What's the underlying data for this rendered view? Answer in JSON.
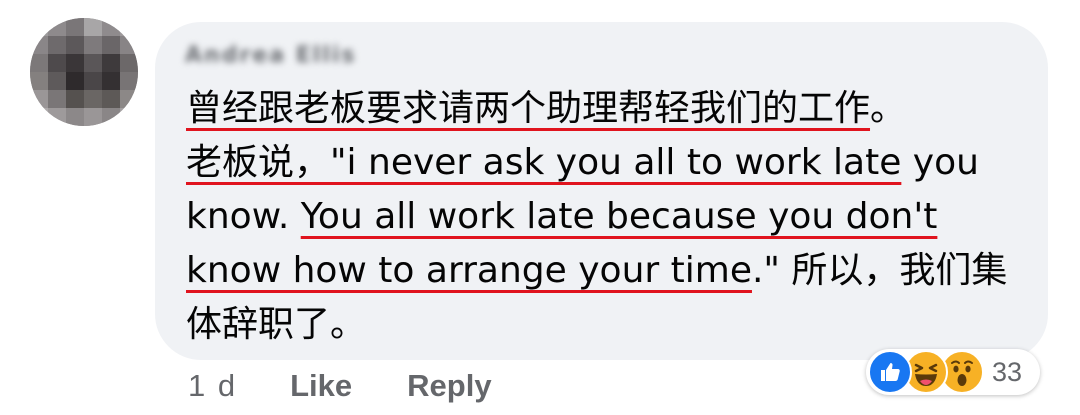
{
  "author": {
    "name": "Andrea Ellis"
  },
  "comment": {
    "segments": [
      {
        "text": "曾经跟老板要求请两个助理帮轻我们的工作",
        "underline": true
      },
      {
        "text": "。",
        "underline": false
      },
      {
        "text": "\n",
        "underline": false
      },
      {
        "text": "老板说，\"i never ask you all to work late",
        "underline": true
      },
      {
        "text": " you know. ",
        "underline": false
      },
      {
        "text": "You all work late because you don't know how to arrange your time",
        "underline": true
      },
      {
        "text": ".\" 所以，我们集体辞职了。",
        "underline": false
      }
    ]
  },
  "meta": {
    "time": "1 d",
    "like_label": "Like",
    "reply_label": "Reply"
  },
  "reactions": {
    "count": "33",
    "icons": [
      "like-reaction-icon",
      "haha-reaction-icon",
      "wow-reaction-icon"
    ]
  },
  "colors": {
    "bubble": "#f0f2f5",
    "underline": "#e0141e",
    "meta_text": "#65676b",
    "like_blue": "#1877f2",
    "emoji_yellow": "#f7b125"
  }
}
